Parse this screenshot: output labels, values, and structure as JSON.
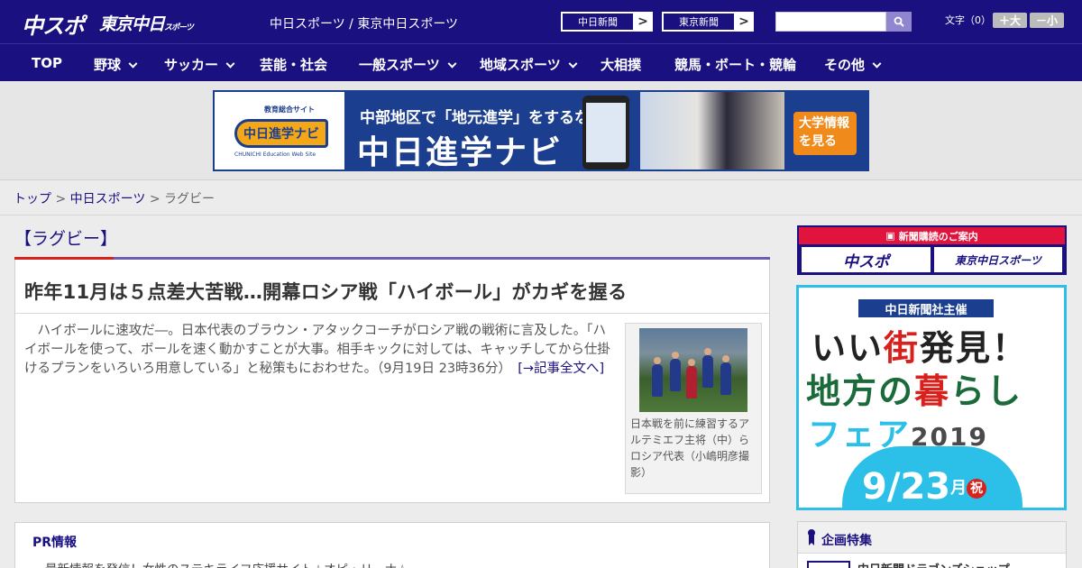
{
  "header": {
    "logo_chuspo": "中スポ",
    "logo_tokyo": "東京中日",
    "logo_tokyo_small": "スポーツ",
    "site_link": "中日スポーツ / 東京中日スポーツ",
    "newspaper_buttons": [
      {
        "label": "中日新聞",
        "arrow": ">"
      },
      {
        "label": "東京新聞",
        "arrow": ">"
      }
    ],
    "search_placeholder": "",
    "font_size": {
      "label": "文字（0）",
      "bigger": "＋大",
      "smaller": "－小"
    }
  },
  "nav": {
    "items": [
      {
        "label": "TOP",
        "has_dropdown": false
      },
      {
        "label": "野球",
        "has_dropdown": true
      },
      {
        "label": "サッカー",
        "has_dropdown": true
      },
      {
        "label": "芸能・社会",
        "has_dropdown": false
      },
      {
        "label": "一般スポーツ",
        "has_dropdown": true
      },
      {
        "label": "地域スポーツ",
        "has_dropdown": true
      },
      {
        "label": "大相撲",
        "has_dropdown": false
      },
      {
        "label": "競馬・ボート・競輪",
        "has_dropdown": false
      },
      {
        "label": "その他",
        "has_dropdown": true
      }
    ]
  },
  "banner": {
    "logo_top": "教育総合サイト",
    "logo_main": "中日進学ナビ",
    "logo_web": "CHUNICHI Education Web Site",
    "subtitle": "中部地区で「地元進学」をするなら",
    "title": "中日進学ナビ",
    "cta_line1": "大学情報",
    "cta_line2": "を見る"
  },
  "breadcrumb": {
    "items": [
      "トップ",
      "中日スポーツ",
      "ラグビー"
    ],
    "separator": ">"
  },
  "article": {
    "category": "【ラグビー】",
    "headline": "昨年11月は５点差大苦戦…開幕ロシア戦「ハイボール」がカギを握る",
    "body": "ハイボールに速攻だ―。日本代表のブラウン・アタックコーチがロシア戦の戦術に言及した。「ハイボールを使って、ボールを速く動かすことが大事。相手キックに対しては、キャッチしてから仕掛けるプランをいろいろ用意している」と秘策もにおわせた。（9月19日 23時36分）",
    "read_more": "[→記事全文へ]",
    "photo_caption": "日本戦を前に練習するアルテミエフ主将（中）らロシア代表（小嶋明彦撮影）"
  },
  "pr": {
    "title": "PR情報",
    "items": [
      "最新情報を発信！女性のステキライフ応援サイト☆オピ・リーナ☆"
    ]
  },
  "sidebar": {
    "subscription_header": "新聞購読のご案内",
    "subscription_buttons": [
      "中スポ",
      "東京中日スポーツ"
    ],
    "fair_ad": {
      "badge": "中日新聞社主催",
      "line1_a": "いい",
      "line1_b": "街",
      "line1_c": "発見！",
      "line2_a": "地方の",
      "line2_b": "暮",
      "line2_c": "らし",
      "line3_a": "フェア",
      "line3_b": "2019",
      "date": "9/23",
      "date_day": "月",
      "date_holiday": "祝"
    },
    "special_title": "企画特集",
    "special_items": [
      "中日新聞ドラゴンズショップ"
    ]
  },
  "colors": {
    "brand_navy": "#1a1080",
    "accent_red": "#d8201c",
    "fair_cyan": "#2cc0e8",
    "banner_blue": "#1c3e8e",
    "cta_orange": "#f08a1a"
  }
}
